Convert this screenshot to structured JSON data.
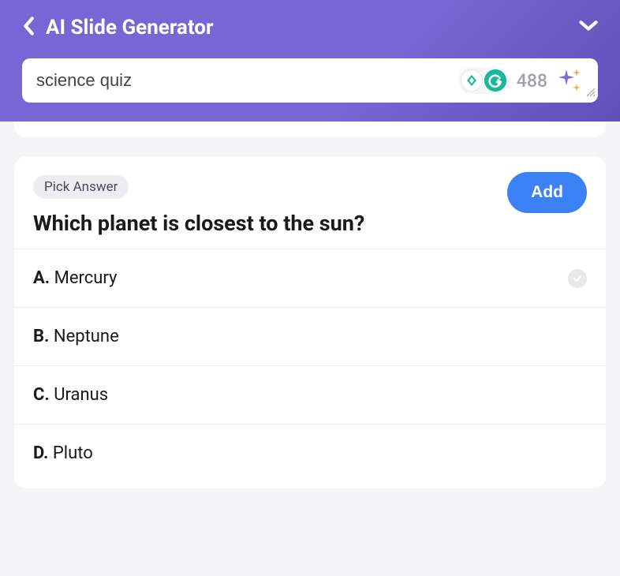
{
  "header": {
    "title": "AI Slide Generator",
    "search_value": "science quiz",
    "char_count": "488"
  },
  "question": {
    "tag": "Pick Answer",
    "text": "Which planet is closest to the sun?",
    "add_label": "Add"
  },
  "answers": [
    {
      "letter": "A.",
      "text": "Mercury",
      "correct": true
    },
    {
      "letter": "B.",
      "text": "Neptune",
      "correct": false
    },
    {
      "letter": "C.",
      "text": "Uranus",
      "correct": false
    },
    {
      "letter": "D.",
      "text": "Pluto",
      "correct": false
    }
  ]
}
